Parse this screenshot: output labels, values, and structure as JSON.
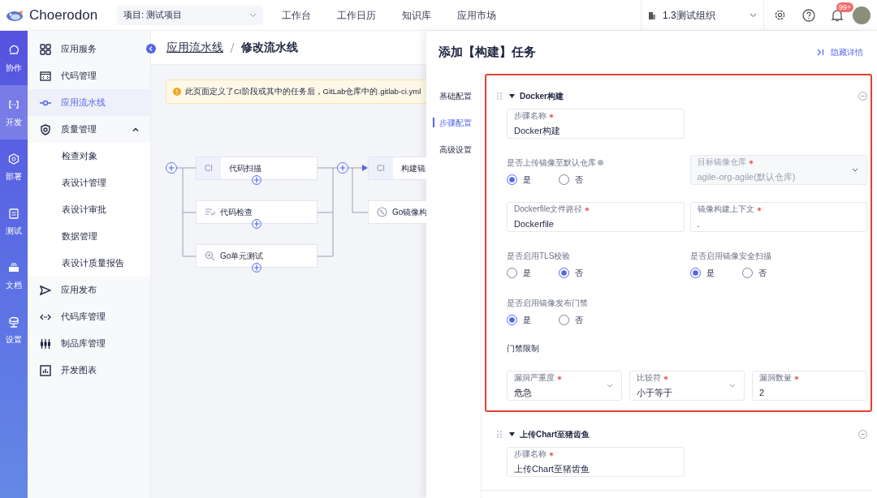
{
  "header": {
    "logo": "Choerodon",
    "project": "项目: 测试项目",
    "nav": [
      {
        "label": "工作台"
      },
      {
        "label": "工作日历"
      },
      {
        "label": "知识库"
      },
      {
        "label": "应用市场"
      }
    ],
    "organization": "1.3测试组织",
    "notification_badge": "99+"
  },
  "rail": [
    {
      "label": "协作",
      "selected": false
    },
    {
      "label": "开发",
      "selected": true
    },
    {
      "label": "部署",
      "selected": false
    },
    {
      "label": "测试",
      "selected": false
    },
    {
      "label": "文档",
      "selected": false
    },
    {
      "label": "设置",
      "selected": false
    }
  ],
  "sidebar": {
    "items": [
      {
        "label": "应用服务",
        "selected": false
      },
      {
        "label": "代码管理",
        "selected": false
      },
      {
        "label": "应用流水线",
        "selected": true
      },
      {
        "label": "质量管理",
        "selected": false,
        "expanded": true,
        "children": [
          {
            "label": "检查对象",
            "selected": false
          },
          {
            "label": "表设计管理",
            "selected": false
          },
          {
            "label": "表设计审批",
            "selected": false
          },
          {
            "label": "数据管理",
            "selected": false
          },
          {
            "label": "表设计质量报告",
            "selected": false
          }
        ]
      },
      {
        "label": "应用发布",
        "selected": false
      },
      {
        "label": "代码库管理",
        "selected": false
      },
      {
        "label": "制品库管理",
        "selected": false
      },
      {
        "label": "开发图表",
        "selected": false
      }
    ]
  },
  "breadcrumb": {
    "parent": "应用流水线",
    "current": "修改流水线"
  },
  "notice": "此页面定义了CI阶段或其中的任务后，GitLab仓库中的.gitlab-ci.yml",
  "pipeline": {
    "stages": [
      {
        "jobs": [
          {
            "kind": "ci",
            "tag": "CI",
            "label": "代码扫描"
          },
          {
            "kind": "lint",
            "label": "代码检查"
          },
          {
            "kind": "test",
            "label": "Go单元测试"
          }
        ]
      },
      {
        "jobs": [
          {
            "kind": "ci",
            "tag": "CI",
            "label": "构建镜"
          },
          {
            "kind": "image",
            "label": "Go镜像构"
          }
        ]
      }
    ]
  },
  "panel": {
    "title": "添加【构建】任务",
    "hide_link": "隐藏详情",
    "nav": [
      {
        "label": "基础配置",
        "selected": false
      },
      {
        "label": "步骤配置",
        "selected": true
      },
      {
        "label": "高级设置",
        "selected": false
      }
    ],
    "steps": [
      {
        "title": "Docker构建",
        "expanded": true,
        "highlighted": true,
        "rows": [
          {
            "items": [
              {
                "kind": "input",
                "label": "步骤名称",
                "required": true,
                "value": "Docker构建"
              }
            ]
          },
          {
            "items": [
              {
                "kind": "radio",
                "label": "是否上传镜像至默认仓库",
                "hint": true,
                "options": [
                  {
                    "label": "是",
                    "selected": true
                  },
                  {
                    "label": "否",
                    "selected": false
                  }
                ]
              },
              {
                "kind": "select",
                "label": "目标镜像仓库",
                "required": true,
                "value": "agile-org-agile(默认仓库)",
                "disabled": true
              }
            ]
          },
          {
            "items": [
              {
                "kind": "input",
                "label": "Dockerfile文件路径",
                "required": true,
                "value": "Dockerfile"
              },
              {
                "kind": "input",
                "label": "镜像构建上下文",
                "required": true,
                "value": "."
              }
            ]
          },
          {
            "items": [
              {
                "kind": "radio",
                "label": "是否启用TLS校验",
                "options": [
                  {
                    "label": "是",
                    "selected": false
                  },
                  {
                    "label": "否",
                    "selected": true
                  }
                ]
              },
              {
                "kind": "radio",
                "label": "是否启用镜像安全扫描",
                "options": [
                  {
                    "label": "是",
                    "selected": true
                  },
                  {
                    "label": "否",
                    "selected": false
                  }
                ]
              }
            ]
          },
          {
            "items": [
              {
                "kind": "radio",
                "label": "是否启用镜像发布门禁",
                "options": [
                  {
                    "label": "是",
                    "selected": true
                  },
                  {
                    "label": "否",
                    "selected": false
                  }
                ]
              }
            ]
          },
          {
            "items": [
              {
                "kind": "heading",
                "label": "门禁限制"
              }
            ]
          },
          {
            "items": [
              {
                "kind": "select",
                "label": "漏洞严重度",
                "required": true,
                "value": "危急"
              },
              {
                "kind": "select",
                "label": "比较符",
                "required": true,
                "value": "小于等于"
              },
              {
                "kind": "input",
                "label": "漏洞数量",
                "required": true,
                "value": "2"
              }
            ]
          }
        ]
      },
      {
        "title": "上传Chart至猪齿鱼",
        "expanded": true,
        "highlighted": false,
        "rows": [
          {
            "items": [
              {
                "kind": "input",
                "label": "步骤名称",
                "required": true,
                "value": "上传Chart至猪齿鱼"
              }
            ]
          }
        ]
      }
    ]
  }
}
